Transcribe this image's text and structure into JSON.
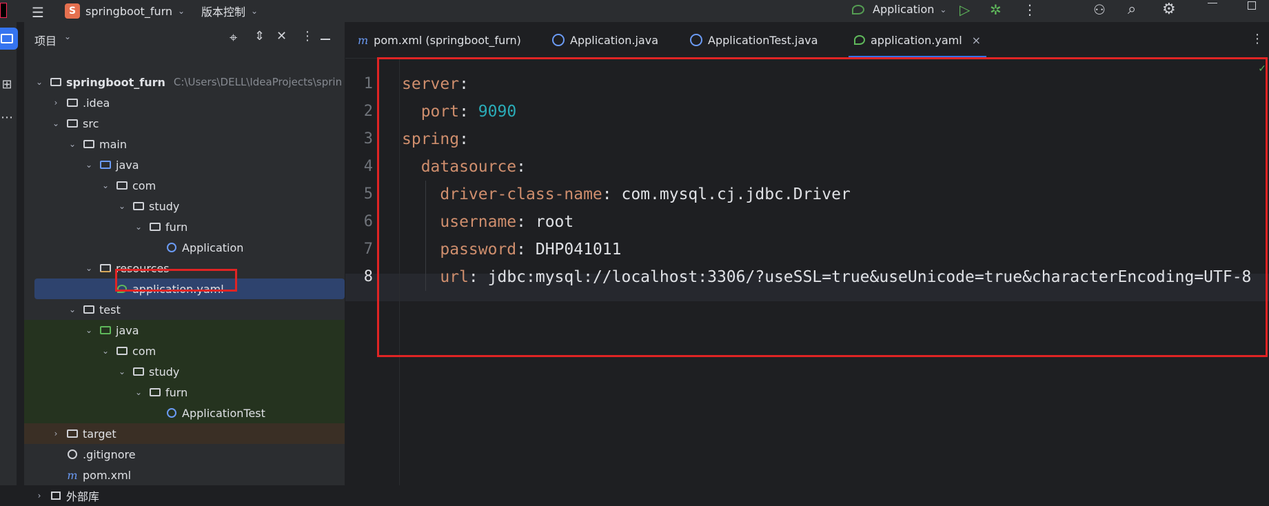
{
  "title_bar": {
    "project_initial": "S",
    "project_name": "springboot_furn",
    "vcs_label": "版本控制",
    "run_config": "Application"
  },
  "project_panel": {
    "title": "项目",
    "tree": [
      {
        "label": "springboot_furn",
        "path": "C:\\Users\\DELL\\IdeaProjects\\sprin",
        "level": 0,
        "expanded": true,
        "icon": "module-folder-icon"
      },
      {
        "label": ".idea",
        "level": 1,
        "expanded": false,
        "icon": "folder-icon"
      },
      {
        "label": "src",
        "level": 1,
        "expanded": true,
        "icon": "folder-icon"
      },
      {
        "label": "main",
        "level": 2,
        "expanded": true,
        "icon": "folder-icon"
      },
      {
        "label": "java",
        "level": 3,
        "expanded": true,
        "icon": "source-folder-icon"
      },
      {
        "label": "com",
        "level": 4,
        "expanded": true,
        "icon": "package-icon"
      },
      {
        "label": "study",
        "level": 5,
        "expanded": true,
        "icon": "package-icon"
      },
      {
        "label": "furn",
        "level": 6,
        "expanded": true,
        "icon": "package-icon"
      },
      {
        "label": "Application",
        "level": 7,
        "icon": "spring-class-icon"
      },
      {
        "label": "resources",
        "level": 3,
        "expanded": true,
        "icon": "resources-folder-icon"
      },
      {
        "label": "application.yaml",
        "level": 4,
        "icon": "yaml-icon",
        "selected": true
      },
      {
        "label": "test",
        "level": 2,
        "expanded": true,
        "icon": "folder-icon"
      },
      {
        "label": "java",
        "level": 3,
        "expanded": true,
        "icon": "test-folder-icon"
      },
      {
        "label": "com",
        "level": 4,
        "expanded": true,
        "icon": "package-icon"
      },
      {
        "label": "study",
        "level": 5,
        "expanded": true,
        "icon": "package-icon"
      },
      {
        "label": "furn",
        "level": 6,
        "expanded": true,
        "icon": "package-icon"
      },
      {
        "label": "ApplicationTest",
        "level": 7,
        "icon": "class-icon"
      },
      {
        "label": "target",
        "level": 1,
        "expanded": false,
        "icon": "folder-icon"
      },
      {
        "label": ".gitignore",
        "level": 1,
        "icon": "ignore-icon"
      },
      {
        "label": "pom.xml",
        "level": 1,
        "icon": "maven-icon"
      },
      {
        "label": "外部库",
        "level": 0,
        "expanded": false,
        "icon": "library-icon"
      }
    ]
  },
  "editor": {
    "tabs": [
      {
        "label": "pom.xml (springboot_furn)",
        "icon": "maven-icon"
      },
      {
        "label": "Application.java",
        "icon": "spring-class-icon"
      },
      {
        "label": "ApplicationTest.java",
        "icon": "class-icon"
      },
      {
        "label": "application.yaml",
        "icon": "yaml-icon",
        "active": true
      }
    ],
    "lines": [
      {
        "num": "1",
        "indent": 0,
        "key": "server",
        "value": ""
      },
      {
        "num": "2",
        "indent": 1,
        "key": "port",
        "value": "9090"
      },
      {
        "num": "3",
        "indent": 0,
        "key": "spring",
        "value": ""
      },
      {
        "num": "4",
        "indent": 1,
        "key": "datasource",
        "value": ""
      },
      {
        "num": "5",
        "indent": 2,
        "key": "driver-class-name",
        "value": "com.mysql.cj.jdbc.Driver"
      },
      {
        "num": "6",
        "indent": 2,
        "key": "username",
        "value": "root"
      },
      {
        "num": "7",
        "indent": 2,
        "key": "password",
        "value": "DHP041011"
      },
      {
        "num": "8",
        "indent": 2,
        "key": "url",
        "value": "jdbc:mysql://localhost:3306/?useSSL=true&useUnicode=true&characterEncoding=UTF-8"
      }
    ]
  }
}
